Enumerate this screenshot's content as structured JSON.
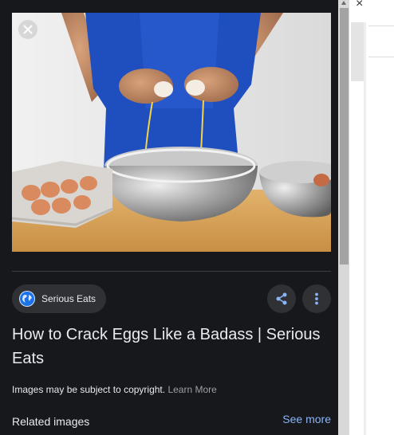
{
  "panel": {
    "source_name": "Serious Eats",
    "title": "How to Crack Eggs Like a Badass | Serious Eats",
    "copyright_text": "Images may be subject to copyright.",
    "learn_more": "Learn More",
    "related_images": "Related images",
    "see_more": "See more"
  },
  "icons": {
    "close": "close-icon",
    "globe": "globe-icon",
    "share": "share-icon",
    "more": "more-vert-icon"
  },
  "colors": {
    "panel_bg": "#17181c",
    "chip_bg": "#303134",
    "text": "#e8eaed",
    "link": "#8ab4f8",
    "apron": "#1f4fbf"
  },
  "window": {
    "close_glyph": "×"
  }
}
